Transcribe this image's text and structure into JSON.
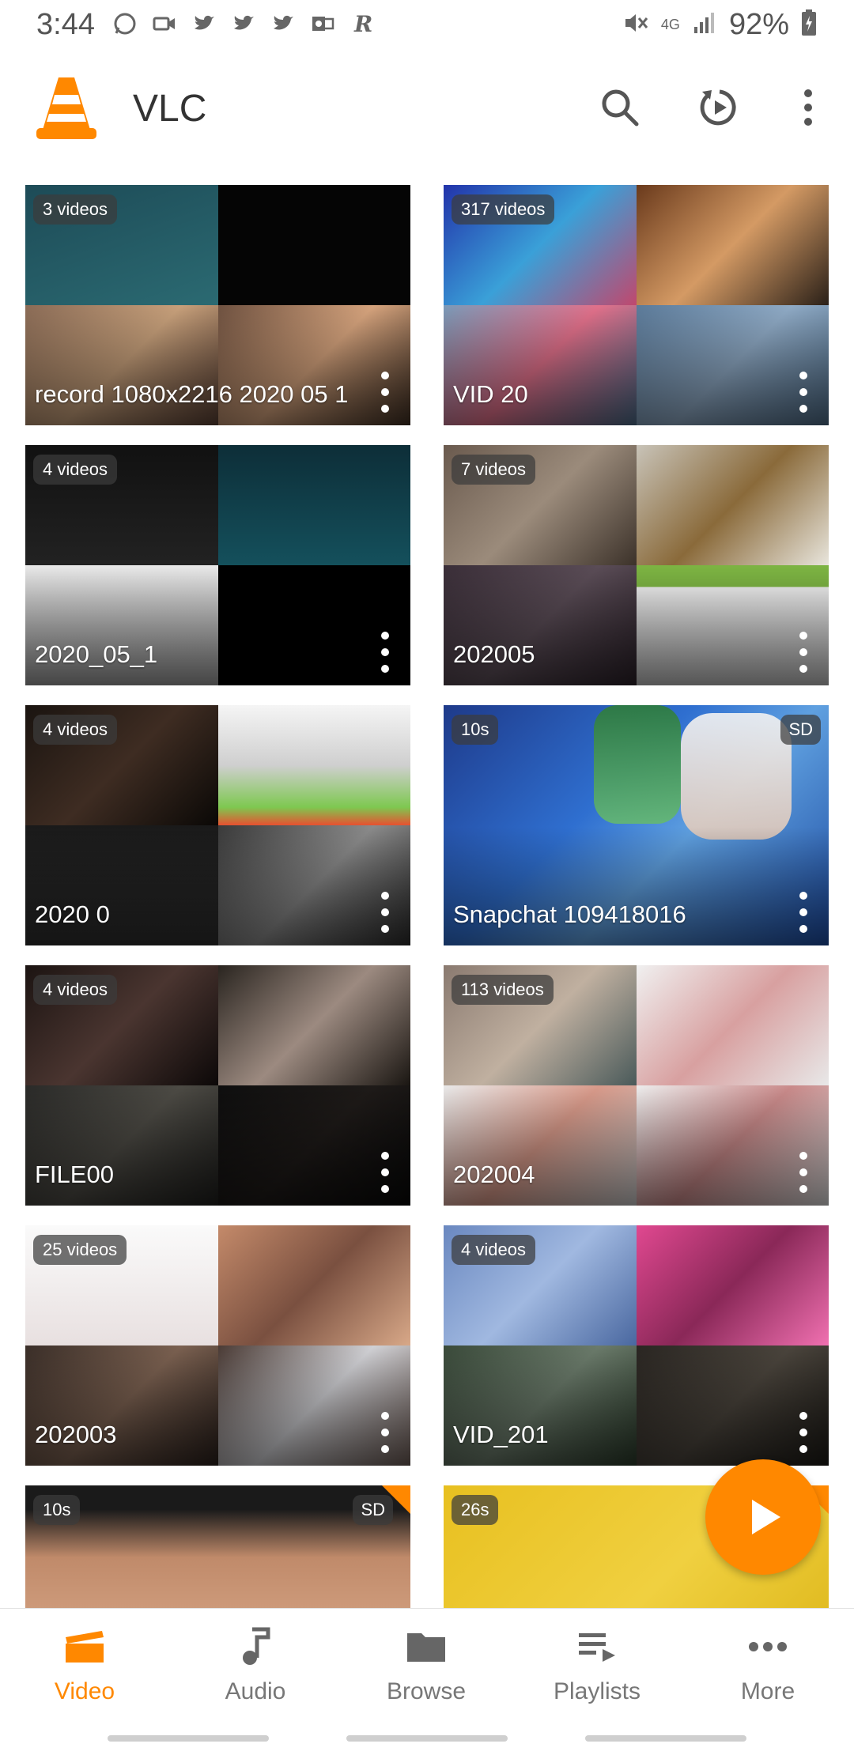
{
  "status_bar": {
    "time": "3:44",
    "battery": "92%",
    "network": "4G"
  },
  "app_bar": {
    "title": "VLC",
    "icons": [
      "search-icon",
      "resume-playback-icon",
      "overflow-menu-icon"
    ]
  },
  "grid": {
    "cards": [
      {
        "title": "record 1080x2216 2020 05 1",
        "badge": "3 videos",
        "sd": ""
      },
      {
        "title": "VID 20",
        "badge": "317 videos",
        "sd": ""
      },
      {
        "title": "2020_05_1",
        "badge": "4 videos",
        "sd": ""
      },
      {
        "title": "202005",
        "badge": "7 videos",
        "sd": ""
      },
      {
        "title": "2020 0",
        "badge": "4 videos",
        "sd": ""
      },
      {
        "title": "Snapchat 109418016",
        "badge": "10s",
        "sd": "SD"
      },
      {
        "title": "FILE00",
        "badge": "4 videos",
        "sd": ""
      },
      {
        "title": "202004",
        "badge": "113 videos",
        "sd": ""
      },
      {
        "title": "202003",
        "badge": "25 videos",
        "sd": ""
      },
      {
        "title": "VID_201",
        "badge": "4 videos",
        "sd": ""
      },
      {
        "title": "",
        "badge": "10s",
        "sd": "SD"
      },
      {
        "title": "",
        "badge": "26s",
        "sd": ""
      }
    ]
  },
  "fab": {
    "icon": "play-icon"
  },
  "bottom_nav": {
    "items": [
      {
        "label": "Video",
        "icon": "video-icon",
        "active": true
      },
      {
        "label": "Audio",
        "icon": "music-note-icon",
        "active": false
      },
      {
        "label": "Browse",
        "icon": "folder-icon",
        "active": false
      },
      {
        "label": "Playlists",
        "icon": "playlist-icon",
        "active": false
      },
      {
        "label": "More",
        "icon": "more-dots-icon",
        "active": false
      }
    ]
  },
  "colors": {
    "accent": "#ff8800",
    "nav_inactive": "#777777",
    "badge_bg": "rgba(60,60,60,0.72)"
  }
}
